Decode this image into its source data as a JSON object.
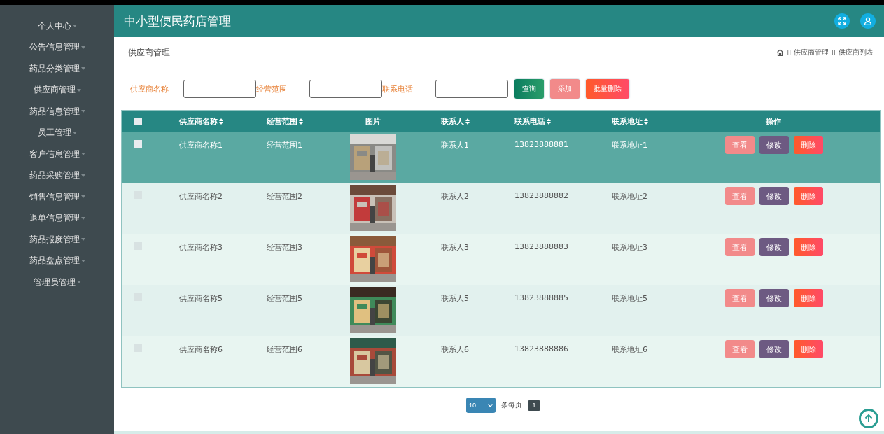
{
  "sidebar": {
    "items": [
      {
        "label": "个人中心"
      },
      {
        "label": "公告信息管理"
      },
      {
        "label": "药品分类管理"
      },
      {
        "label": "供应商管理"
      },
      {
        "label": "药品信息管理"
      },
      {
        "label": "员工管理"
      },
      {
        "label": "客户信息管理"
      },
      {
        "label": "药品采购管理"
      },
      {
        "label": "销售信息管理"
      },
      {
        "label": "退单信息管理"
      },
      {
        "label": "药品报废管理"
      },
      {
        "label": "药品盘点管理"
      },
      {
        "label": "管理员管理"
      }
    ]
  },
  "header": {
    "title": "中小型便民药店管理"
  },
  "page_title": "供应商管理",
  "breadcrumb": [
    {
      "separator": "II",
      "label": "供应商管理"
    },
    {
      "separator": "II",
      "label": "供应商列表"
    }
  ],
  "search": {
    "fields": [
      {
        "label": "供应商名称"
      },
      {
        "label": "经营范围"
      },
      {
        "label": "联系电话"
      }
    ],
    "buttons": [
      {
        "kind": "query",
        "label": "查询"
      },
      {
        "kind": "add",
        "label": "添加"
      },
      {
        "kind": "batch_delete",
        "label": "批量删除"
      }
    ]
  },
  "table": {
    "select_all": {
      "checked": false
    },
    "columns": [
      "供应商名称",
      "经营范围",
      "图片",
      "联系人",
      "联系电话",
      "联系地址",
      "操作"
    ],
    "rows": [
      {
        "selected": true,
        "name": "供应商名称1",
        "scope": "经营范围1",
        "contact": "联系人1",
        "phone": "13823888881",
        "address": "联系地址1",
        "actions": [
          "查看",
          "修改",
          "删除"
        ]
      },
      {
        "selected": false,
        "name": "供应商名称2",
        "scope": "经营范围2",
        "contact": "联系人2",
        "phone": "13823888882",
        "address": "联系地址2",
        "actions": [
          "查看",
          "修改",
          "删除"
        ]
      },
      {
        "selected": false,
        "name": "供应商名称3",
        "scope": "经营范围3",
        "contact": "联系人3",
        "phone": "13823888883",
        "address": "联系地址3",
        "actions": [
          "查看",
          "修改",
          "删除"
        ]
      },
      {
        "selected": false,
        "name": "供应商名称5",
        "scope": "经营范围5",
        "contact": "联系人5",
        "phone": "13823888885",
        "address": "联系地址5",
        "actions": [
          "查看",
          "修改",
          "删除"
        ]
      },
      {
        "selected": false,
        "name": "供应商名称6",
        "scope": "经营范围6",
        "contact": "联系人6",
        "phone": "13823888886",
        "address": "联系地址6",
        "actions": [
          "查看",
          "修改",
          "删除"
        ]
      }
    ]
  },
  "pagination": {
    "page_size": "10",
    "per_page_label": "条每页",
    "pages": [
      {
        "label": "1",
        "selected": true
      }
    ]
  }
}
